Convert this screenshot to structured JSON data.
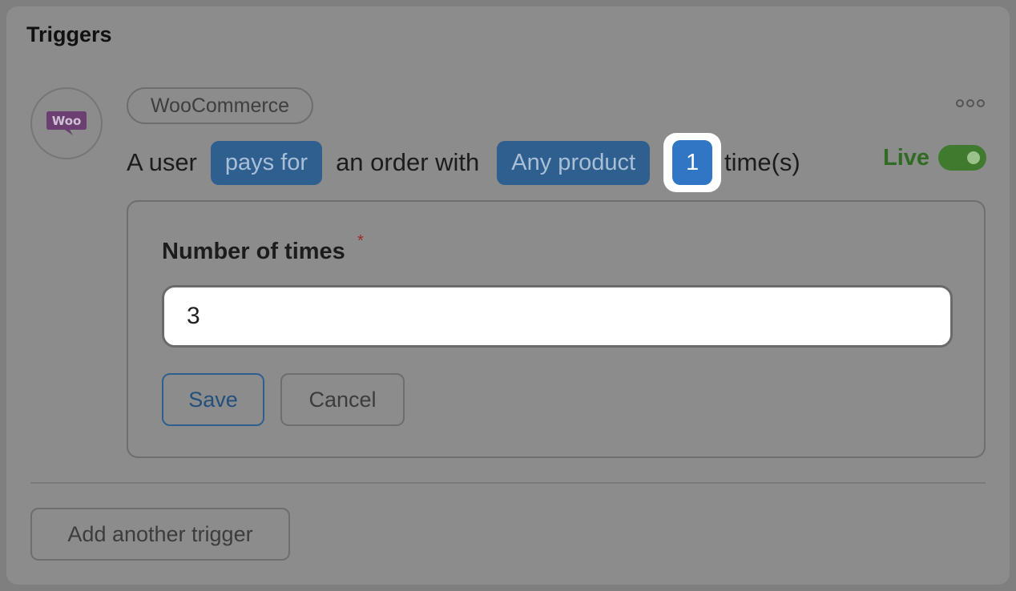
{
  "section": {
    "title": "Triggers"
  },
  "trigger": {
    "integration_icon": "woocommerce-logo",
    "integration_label": "WooCommerce",
    "sentence": {
      "prefix": "A user",
      "action": "pays for",
      "middle": "an order with",
      "product": "Any product",
      "count": "1",
      "suffix": "time(s)"
    },
    "status_label": "Live",
    "status_on": true
  },
  "editor": {
    "field_label": "Number of times",
    "required_mark": "*",
    "field_value": "3",
    "save_label": "Save",
    "cancel_label": "Cancel"
  },
  "footer": {
    "add_label": "Add another trigger"
  },
  "colors": {
    "accent_blue": "#2f5f8f",
    "count_blue": "#3176c4",
    "live_green": "#2f6b22",
    "woo_purple": "#6b3f72"
  }
}
